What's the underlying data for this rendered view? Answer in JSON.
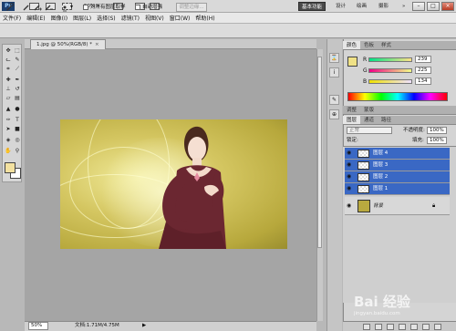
{
  "titlebar": {
    "ps_logo": "Ps",
    "zoom": "50%",
    "workspaces": [
      "基本功能",
      "设计",
      "绘画",
      "摄影"
    ],
    "more": "»"
  },
  "menu": [
    "文件(F)",
    "编辑(E)",
    "图像(I)",
    "图层(L)",
    "选择(S)",
    "滤镜(T)",
    "视图(V)",
    "窗口(W)",
    "帮助(H)"
  ],
  "options": {
    "sample_all_layers": "对所有图层取样",
    "auto_enhance": "自动增强",
    "refine_edge": "调整边缘..."
  },
  "document": {
    "tab_title": "1.jpg @ 50%(RGB/8) *",
    "zoom_value": "50%",
    "doc_info": "文档:1.71M/4.75M"
  },
  "color_panel": {
    "tabs": [
      "颜色",
      "色板",
      "样式"
    ],
    "r": "239",
    "g": "225",
    "b": "134",
    "r_label": "R",
    "g_label": "G",
    "b_label": "B",
    "swatch_color": "#efe186"
  },
  "adjust_tabs": [
    "调整",
    "蒙版"
  ],
  "layers_panel": {
    "tabs": [
      "图层",
      "通道",
      "路径"
    ],
    "blend_mode": "正常",
    "opacity_label": "不透明度:",
    "opacity": "100%",
    "lock_label": "锁定:",
    "fill_label": "填充:",
    "fill": "100%",
    "layers": [
      {
        "name": "图层 4",
        "selected": true
      },
      {
        "name": "图层 3",
        "selected": true
      },
      {
        "name": "图层 2",
        "selected": true
      },
      {
        "name": "图层 1",
        "selected": true
      },
      {
        "name": "背景",
        "selected": false
      }
    ]
  },
  "watermark": {
    "brand": "Bai 经验",
    "url": "jingyan.baidu.com"
  },
  "icons": [
    "move-icon",
    "marquee-icon",
    "lasso-icon",
    "quick-select-icon",
    "crop-icon",
    "eyedropper-icon",
    "healing-icon",
    "brush-icon",
    "stamp-icon",
    "history-brush-icon",
    "eraser-icon",
    "gradient-icon",
    "blur-icon",
    "dodge-icon",
    "pen-icon",
    "type-icon",
    "path-select-icon",
    "shape-icon",
    "3d-icon",
    "hand-icon",
    "zoom-icon"
  ]
}
